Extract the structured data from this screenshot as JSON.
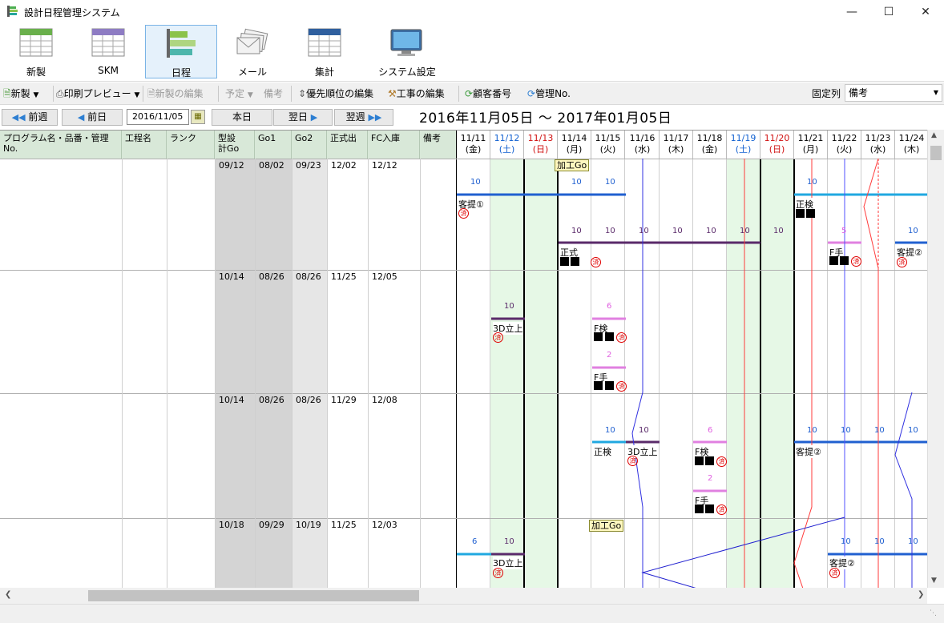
{
  "window": {
    "title": "設計日程管理システム"
  },
  "ribbon": [
    {
      "label": "新製"
    },
    {
      "label": "SKM"
    },
    {
      "label": "日程"
    },
    {
      "label": "メール"
    },
    {
      "label": "集計"
    },
    {
      "label": "システム設定"
    }
  ],
  "toolbar": {
    "new": "新製",
    "print": "印刷プレビュー",
    "edit_new": "新製の編集",
    "plan": "予定",
    "note": "備考",
    "priority": "優先順位の編集",
    "work": "工事の編集",
    "customer": "顧客番号",
    "mgmt": "管理No.",
    "fixed_label": "固定列",
    "fixed_value": "備考"
  },
  "nav": {
    "prev_week": "前週",
    "prev_day": "前日",
    "date": "2016/11/05",
    "today": "本日",
    "next_day": "翌日",
    "next_week": "翌週",
    "range": "2016年11月05日 ～ 2017年01月05日"
  },
  "columns": [
    "プログラム名・品番・管理No.",
    "工程名",
    "ランク",
    "型設計Go",
    "Go1",
    "Go2",
    "正式出",
    "FC入庫",
    "備考"
  ],
  "days": [
    {
      "date": "11/11",
      "dow": "(金)",
      "type": "w"
    },
    {
      "date": "11/12",
      "dow": "(土)",
      "type": "sat"
    },
    {
      "date": "11/13",
      "dow": "(日)",
      "type": "sun"
    },
    {
      "date": "11/14",
      "dow": "(月)",
      "type": "w"
    },
    {
      "date": "11/15",
      "dow": "(火)",
      "type": "w"
    },
    {
      "date": "11/16",
      "dow": "(水)",
      "type": "w"
    },
    {
      "date": "11/17",
      "dow": "(木)",
      "type": "w"
    },
    {
      "date": "11/18",
      "dow": "(金)",
      "type": "w"
    },
    {
      "date": "11/19",
      "dow": "(土)",
      "type": "sat"
    },
    {
      "date": "11/20",
      "dow": "(日)",
      "type": "sun"
    },
    {
      "date": "11/21",
      "dow": "(月)",
      "type": "w"
    },
    {
      "date": "11/22",
      "dow": "(火)",
      "type": "w"
    },
    {
      "date": "11/23",
      "dow": "(水)",
      "type": "w"
    },
    {
      "date": "11/24",
      "dow": "(木)",
      "type": "w"
    }
  ],
  "rows": [
    {
      "go": "09/12",
      "go1": "08/02",
      "go2": "09/23",
      "sei": "12/02",
      "fc": "12/12"
    },
    {
      "go": "10/14",
      "go1": "08/26",
      "go2": "08/26",
      "sei": "11/25",
      "fc": "12/05"
    },
    {
      "go": "10/14",
      "go1": "08/26",
      "go2": "08/26",
      "sei": "11/29",
      "fc": "12/08"
    },
    {
      "go": "10/18",
      "go1": "09/29",
      "go2": "10/19",
      "sei": "11/25",
      "fc": "12/03"
    }
  ],
  "marks": {
    "kako": "加工Go",
    "zumi": "済",
    "n10": "10",
    "n6": "6",
    "n5": "5",
    "n2": "2",
    "l_kyakutei1": "客提①",
    "l_kyakutei2": "客提②",
    "l_seiken": "正検",
    "l_seishiki": "正式",
    "l_fken": "F検",
    "l_fte": "F手",
    "l_3d": "3D立上"
  }
}
